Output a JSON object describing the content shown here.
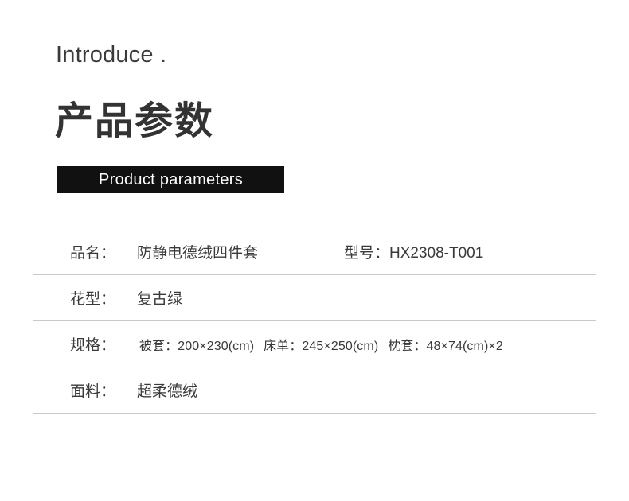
{
  "header": {
    "eyebrow": "Introduce .",
    "title": "产品参数",
    "banner_label": "Product parameters"
  },
  "colors": {
    "banner_background": "#111111",
    "banner_text": "#ffffff",
    "text": "#3a3a3a",
    "divider": "#c9c9c9",
    "page_background": "#ffffff"
  },
  "parameters": {
    "rows": [
      {
        "label": "品名：",
        "value": "防静电德绒四件套",
        "extra_label": "型号：",
        "extra_value": "HX2308-T001"
      },
      {
        "label": "花型：",
        "value": "复古绿"
      },
      {
        "label": "规格：",
        "segments": [
          "被套：200×230(cm)",
          "床单：245×250(cm)",
          "枕套：48×74(cm)×2"
        ]
      },
      {
        "label": "面料：",
        "value": "超柔德绒"
      }
    ]
  }
}
